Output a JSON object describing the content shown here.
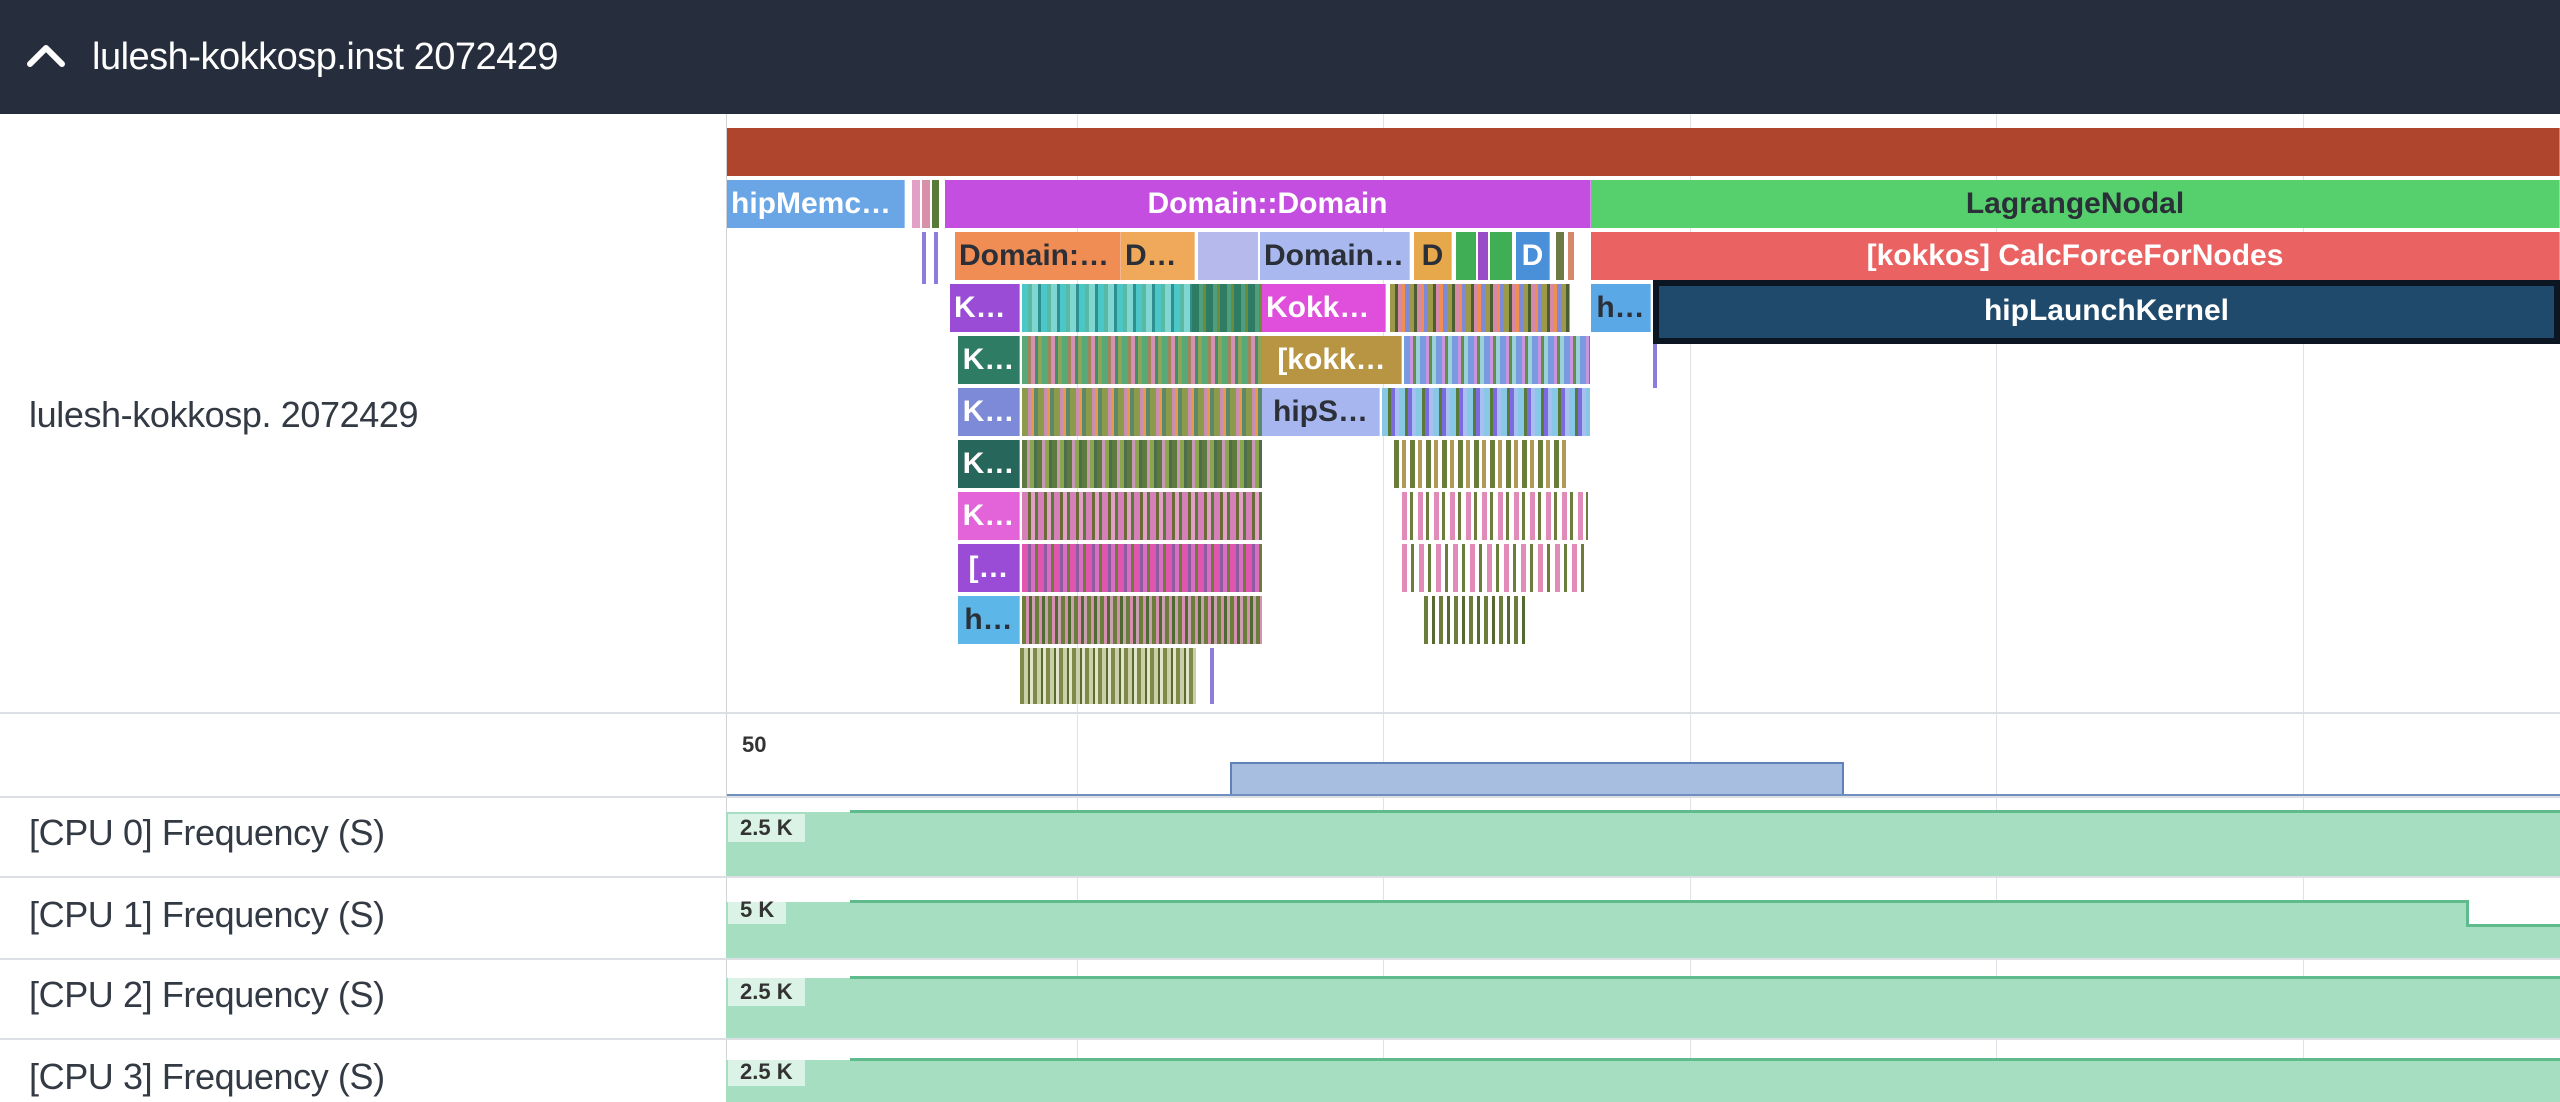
{
  "header": {
    "title": "lulesh-kokkosp.inst 2072429",
    "toggle_icon": "chevron-up-icon"
  },
  "process_track": {
    "label": "lulesh-kokkosp. 2072429"
  },
  "slices": {
    "hipMemcpy": "hipMemcp…",
    "domain_domain": "Domain::Domain",
    "lagrange_nodal": "LagrangeNodal",
    "domain_a": "Domain::…",
    "domain_b": "Do…",
    "domain_c": "Domain::…",
    "d1": "D",
    "d2": "D",
    "calc_force": "[kokkos] CalcForceForNodes",
    "ko": "Ko…",
    "kokko": "Kokko…",
    "h_short": "h…",
    "hip_launch": "hipLaunchKernel",
    "k1": "K…",
    "kokk_bracket": "[kokk…",
    "k2": "K…",
    "hips": "hipS…",
    "k3": "K…",
    "k4": "K…",
    "bracket": "[…",
    "h2": "h…"
  },
  "counter_track": {
    "max_label": "50"
  },
  "cpu_tracks": [
    {
      "label": "[CPU 0] Frequency (S)",
      "value": "2.5 K"
    },
    {
      "label": "[CPU 1] Frequency (S)",
      "value": "5 K"
    },
    {
      "label": "[CPU 2] Frequency (S)",
      "value": "2.5 K"
    },
    {
      "label": "[CPU 3] Frequency (S)",
      "value": "2.5 K"
    }
  ],
  "colors": {
    "header_bg": "#262d3c",
    "root_slice": "#b0452d",
    "domain_domain": "#c44ee0",
    "lagrange": "#56d06c",
    "calc_force": "#ea6262",
    "hip_launch": "#1f4a6b",
    "cpu_fill": "#a6dec2"
  }
}
